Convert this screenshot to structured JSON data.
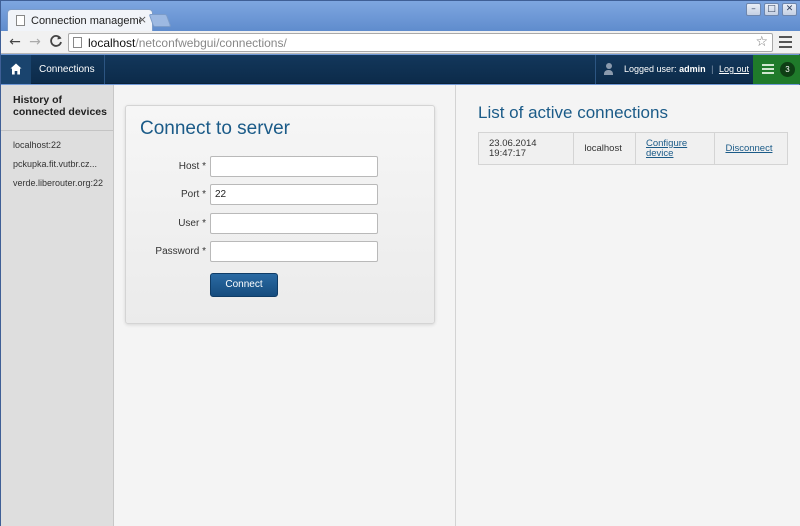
{
  "browser": {
    "tab_title": "Connection manageme",
    "tab_close": "×",
    "url_host": "localhost",
    "url_path": "/netconfwebgui/connections/",
    "back": "←",
    "forward": "→",
    "reload": "C",
    "star": "☆",
    "window_buttons": {
      "minimize": "–",
      "maximize": "□",
      "close": "✕"
    }
  },
  "header": {
    "connections_label": "Connections",
    "logged_user_prefix": "Logged user:",
    "username": "admin",
    "separator": "|",
    "logout_label": "Log out",
    "notification_count": "3",
    "colors": {
      "header_bg": "#0c2b4a",
      "notification_bg": "#1f7a2a"
    }
  },
  "sidebar": {
    "title": "History of connected devices",
    "items": [
      "localhost:22",
      "pckupka.fit.vutbr.cz...",
      "verde.liberouter.org:22"
    ]
  },
  "connect_form": {
    "title": "Connect to server",
    "fields": [
      {
        "label": "Host *",
        "value": ""
      },
      {
        "label": "Port *",
        "value": "22"
      },
      {
        "label": "User *",
        "value": ""
      },
      {
        "label": "Password *",
        "value": ""
      }
    ],
    "submit_label": "Connect"
  },
  "active_connections": {
    "title": "List of active connections",
    "rows": [
      {
        "date": "23.06.2014",
        "time": "19:47:17",
        "host": "localhost",
        "configure_label": "Configure device",
        "disconnect_label": "Disconnect"
      }
    ]
  }
}
